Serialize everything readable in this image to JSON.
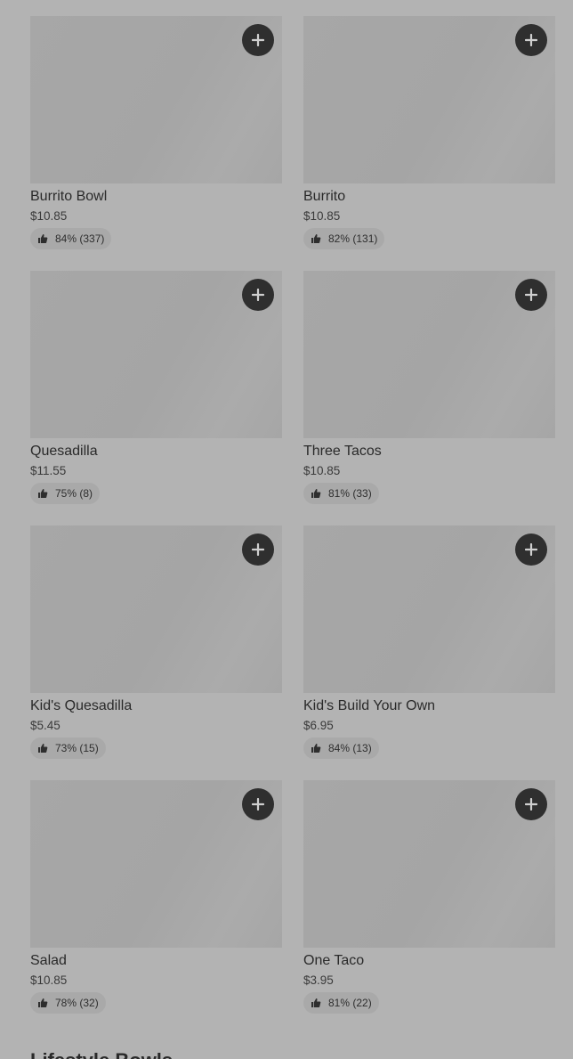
{
  "items": [
    {
      "name": "Burrito Bowl",
      "price": "$10.85",
      "rating": "84% (337)"
    },
    {
      "name": "Burrito",
      "price": "$10.85",
      "rating": "82% (131)"
    },
    {
      "name": "Quesadilla",
      "price": "$11.55",
      "rating": "75% (8)"
    },
    {
      "name": "Three Tacos",
      "price": "$10.85",
      "rating": "81% (33)"
    },
    {
      "name": "Kid's Quesadilla",
      "price": "$5.45",
      "rating": "73% (15)"
    },
    {
      "name": "Kid's Build Your Own",
      "price": "$6.95",
      "rating": "84% (13)"
    },
    {
      "name": "Salad",
      "price": "$10.85",
      "rating": "78% (32)"
    },
    {
      "name": "One Taco",
      "price": "$3.95",
      "rating": "81% (22)"
    }
  ],
  "next_section": {
    "title": "Lifestyle Bowls"
  },
  "icons": {
    "add": "plus-icon",
    "rating": "thumbs-up-icon"
  },
  "colors": {
    "overlay_bg": "#b3b3b3",
    "add_button": "#2f2f2f"
  }
}
